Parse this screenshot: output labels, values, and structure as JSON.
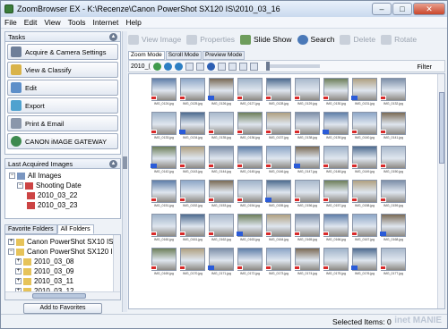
{
  "title": "ZoomBrowser EX - K:\\Recenze\\Canon PowerShot SX120 IS\\2010_03_16",
  "window_buttons": [
    "–",
    "□",
    "✕"
  ],
  "menu": [
    "File",
    "Edit",
    "View",
    "Tools",
    "Internet",
    "Help"
  ],
  "tasks": {
    "header": "Tasks",
    "items": [
      "Acquire & Camera Settings",
      "View & Classify",
      "Edit",
      "Export",
      "Print & Email",
      "CANON iMAGE GATEWAY"
    ]
  },
  "recent": {
    "header": "Last Acquired Images",
    "all": "All Images",
    "shooting": "Shooting Date",
    "dates": [
      "2010_03_22",
      "2010_03_23"
    ]
  },
  "folder_tabs": [
    "Favorite Folders",
    "All Folders"
  ],
  "folders": [
    "Canon PowerShot SX10 IS",
    "Canon PowerShot SX120 I",
    "2010_03_08",
    "2010_03_09",
    "2010_03_11",
    "2010_03_12"
  ],
  "add_favorites": "Add to Favorites",
  "toolbar": {
    "view_image": "View Image",
    "properties": "Properties",
    "slide_show": "Slide Show",
    "search": "Search",
    "delete": "Delete",
    "rotate": "Rotate"
  },
  "view_tabs": [
    "Zoom Mode",
    "Scroll Mode",
    "Preview Mode"
  ],
  "nav_label": "2010_(",
  "filter": "Filter",
  "status": "Selected Items: 0",
  "watermark": "inet MANIE",
  "thumbnail_rows": [
    [
      "IMG_0124.jpg",
      "IMG_0125.jpg",
      "IMG_0126.jpg",
      "IMG_0127.jpg",
      "IMG_0128.jpg",
      "IMG_0129.jpg",
      "IMG_0130.jpg",
      "IMG_0131.jpg",
      "IMG_0132.jpg"
    ],
    [
      "IMG_0133.jpg",
      "IMG_0134.jpg",
      "IMG_0135.jpg",
      "IMG_0136.jpg",
      "IMG_0137.jpg",
      "IMG_0138.jpg",
      "IMG_0139.jpg",
      "IMG_0140.jpg",
      "IMG_0141.jpg"
    ],
    [
      "IMG_0142.jpg",
      "IMG_0143.jpg",
      "IMG_0144.jpg",
      "IMG_0145.jpg",
      "IMG_0146.jpg",
      "IMG_0147.jpg",
      "IMG_0148.jpg",
      "IMG_0149.jpg",
      "IMG_0150.jpg"
    ],
    [
      "IMG_0151.jpg",
      "IMG_0152.jpg",
      "IMG_0153.jpg",
      "IMG_0154.jpg",
      "IMG_0155.jpg",
      "IMG_0156.jpg",
      "IMG_0157.jpg",
      "IMG_0158.jpg",
      "IMG_0159.jpg"
    ],
    [
      "IMG_0160.jpg",
      "IMG_0161.jpg",
      "IMG_0162.jpg",
      "IMG_0163.jpg",
      "IMG_0164.jpg",
      "IMG_0165.jpg",
      "IMG_0166.jpg",
      "IMG_0167.jpg",
      "IMG_0168.jpg"
    ],
    [
      "IMG_0169.jpg",
      "IMG_0170.jpg",
      "IMG_0171.jpg",
      "IMG_0172.jpg",
      "IMG_0173.jpg",
      "IMG_0174.jpg",
      "IMG_0175.jpg",
      "IMG_0176.jpg",
      "IMG_0177.jpg"
    ]
  ],
  "thumb_colors": [
    "#5f7ea8",
    "#8da6c7",
    "#7a6a55",
    "#9fb3c9",
    "#4e6b8f",
    "#a9b9cc",
    "#6d7f5a",
    "#b0a080",
    "#7d8fa8"
  ]
}
